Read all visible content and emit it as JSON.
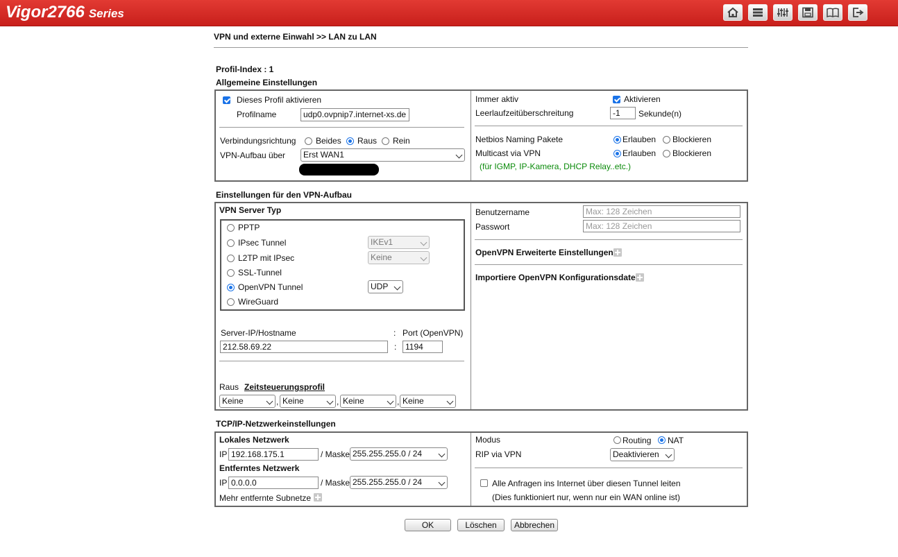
{
  "brand": {
    "name": "Vigor2766",
    "series": "Series"
  },
  "toolbar_icons": [
    "home-icon",
    "layout-icon",
    "settings-sliders-icon",
    "save-icon",
    "manual-book-icon",
    "logout-icon"
  ],
  "breadcrumb": "VPN und externe Einwahl >> LAN zu LAN",
  "profile_index": "Profil-Index : 1",
  "general": {
    "heading": "Allgemeine Einstellungen",
    "enable_profile": "Dieses Profil aktivieren",
    "enable_profile_checked": true,
    "profile_name_label": "Profilname",
    "profile_name_value": "udp0.ovpnip7.internet-xs.de",
    "direction_label": "Verbindungsrichtung",
    "direction_options": [
      "Beides",
      "Raus",
      "Rein"
    ],
    "direction_selected": "Raus",
    "vpn_via_label": "VPN-Aufbau über",
    "vpn_via_value": "Erst WAN1",
    "always_on_label": "Immer aktiv",
    "always_on_checkbox": "Aktivieren",
    "always_on_checked": true,
    "idle_label": "Leerlaufzeitüberschreitung",
    "idle_value": "-1",
    "idle_unit": "Sekunde(n)",
    "netbios_label": "Netbios Naming Pakete",
    "netbios_options": [
      "Erlauben",
      "Blockieren"
    ],
    "netbios_selected": "Erlauben",
    "multicast_label": "Multicast via VPN",
    "multicast_options": [
      "Erlauben",
      "Blockieren"
    ],
    "multicast_selected": "Erlauben",
    "multicast_note": "(für IGMP, IP-Kamera, DHCP Relay..etc.)"
  },
  "vpn_setup": {
    "heading": "Einstellungen für den VPN-Aufbau",
    "server_type_heading": "VPN Server Typ",
    "server_types": [
      "PPTP",
      "IPsec Tunnel",
      "L2TP mit IPsec",
      "SSL-Tunnel",
      "OpenVPN Tunnel",
      "WireGuard"
    ],
    "server_type_selected": "OpenVPN Tunnel",
    "ipsec_select": "IKEv1",
    "l2tp_select": "Keine",
    "openvpn_select": "UDP",
    "server_label": "Server-IP/Hostname",
    "server_value": "212.58.69.22",
    "colon": ":",
    "port_label": "Port (OpenVPN)",
    "port_value": "1194",
    "out_label": "Raus",
    "schedule_link": "Zeitsteuerungsprofil",
    "schedule_values": [
      "Keine",
      "Keine",
      "Keine",
      "Keine"
    ],
    "comma": ",",
    "username_label": "Benutzername",
    "username_placeholder": "Max: 128 Zeichen",
    "password_label": "Passwort",
    "password_placeholder": "Max: 128 Zeichen",
    "openvpn_advanced": "OpenVPN Erweiterte Einstellungen",
    "openvpn_import": "Importiere OpenVPN Konfigurationsdatei"
  },
  "tcpip": {
    "heading": "TCP/IP-Netzwerkeinstellungen",
    "local_heading": "Lokales Netzwerk",
    "ip_label": "IP",
    "mask_label": "/ Maske",
    "local_ip": "192.168.175.1",
    "local_mask": "255.255.255.0 / 24",
    "remote_heading": "Entferntes Netzwerk",
    "remote_ip": "0.0.0.0",
    "remote_mask": "255.255.255.0 / 24",
    "more_subnets": "Mehr entfernte Subnetze",
    "mode_label": "Modus",
    "mode_options": [
      "Routing",
      "NAT"
    ],
    "mode_selected": "NAT",
    "rip_label": "RIP via VPN",
    "rip_value": "Deaktivieren",
    "route_all_label": "Alle Anfragen ins Internet über diesen Tunnel leiten",
    "route_all_checked": false,
    "route_all_note": "(Dies funktioniert nur, wenn nur ein WAN online ist)"
  },
  "buttons": {
    "ok": "OK",
    "delete": "Löschen",
    "cancel": "Abbrechen"
  },
  "colors": {
    "header_red": "#d42a24",
    "accent_blue": "#1a73e8",
    "note_green": "#0a8a0a"
  }
}
